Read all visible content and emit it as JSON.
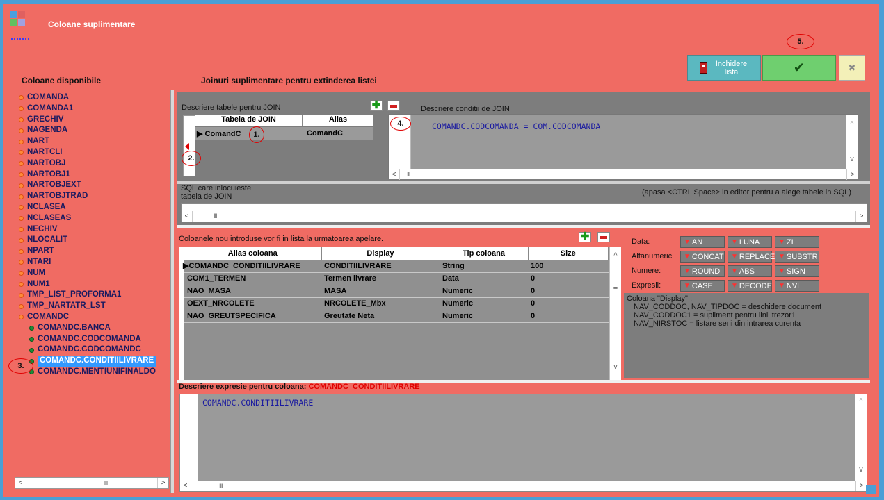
{
  "window": {
    "title": "Coloane suplimentare"
  },
  "toolbar": {
    "close_label": "Inchidere lista",
    "ok_symbol": "✔",
    "cancel_symbol": "✖",
    "step5": "5."
  },
  "left": {
    "title": "Coloane disponibile",
    "items": [
      "COMANDA",
      "COMANDA1",
      "GRECHIV",
      "NAGENDA",
      "NART",
      "NARTCLI",
      "NARTOBJ",
      "NARTOBJ1",
      "NARTOBJEXT",
      "NARTOBJTRAD",
      "NCLASEA",
      "NCLASEAS",
      "NECHIV",
      "NLOCALIT",
      "NPART",
      "NTARI",
      "NUM",
      "NUM1",
      "TMP_LIST_PROFORMA1",
      "TMP_NARTATR_LST",
      "COMANDC"
    ],
    "children": [
      "COMANDC.BANCA",
      "COMANDC.CODCOMANDA",
      "COMANDC.CODCOMANDC",
      "COMANDC.CONDITIILIVRARE",
      "COMANDC.MENTIUNIFINALDO"
    ],
    "step3": "3."
  },
  "join": {
    "section_title": "Joinuri suplimentare pentru extinderea listei",
    "tables_label": "Descriere tabele pentru JOIN",
    "conditions_label": "Descriere conditii de JOIN",
    "col_table": "Tabela de JOIN",
    "col_alias": "Alias",
    "row_table": "ComandC",
    "row_alias": "ComandC",
    "condition": "COMANDC.CODCOMANDA = COM.CODCOMANDA",
    "sql_label": "SQL care inlocuieste tabela de JOIN",
    "sql_hint": "(apasa <CTRL Space> in editor pentru a alege tabele in SQL)",
    "step1": "1.",
    "step2": "2.",
    "step4": "4."
  },
  "columns": {
    "note": "Coloanele nou introduse vor fi in lista la urmatoarea apelare.",
    "headers": [
      "Alias coloana",
      "Display",
      "Tip coloana",
      "Size"
    ],
    "rows": [
      [
        "COMANDC_CONDITIILIVRARE",
        "CONDITIILIVRARE",
        "String",
        "100"
      ],
      [
        "COM1_TERMEN",
        "Termen livrare",
        "Data",
        "0"
      ],
      [
        "NAO_MASA",
        "MASA",
        "Numeric",
        "0"
      ],
      [
        "OEXT_NRCOLETE",
        "NRCOLETE_Mbx",
        "Numeric",
        "0"
      ],
      [
        "NAO_GREUTSPECIFICA",
        "Greutate Neta",
        "Numeric",
        "0"
      ]
    ]
  },
  "functions": {
    "data_label": "Data:",
    "alfa_label": "Alfanumeric",
    "num_label": "Numere:",
    "expr_label": "Expresii:",
    "data": [
      "AN",
      "LUNA",
      "ZI"
    ],
    "alfa": [
      "CONCAT",
      "REPLACE",
      "SUBSTR"
    ],
    "num": [
      "ROUND",
      "ABS",
      "SIGN"
    ],
    "expr": [
      "CASE",
      "DECODE",
      "NVL"
    ],
    "help_title": "Coloana \"Display\" :",
    "help1": "NAV_CODDOC, NAV_TIPDOC = deschidere document",
    "help2": "NAV_CODDOC1 = supliment pentru linii trezor1",
    "help3": "NAV_NIRSTOC = listare serii din intrarea curenta"
  },
  "expression": {
    "label": "Descriere expresie pentru coloana:",
    "column": "COMANDC_CONDITIILIVRARE",
    "text": "COMANDC.CONDITIILIVRARE"
  },
  "colors": {
    "background": "#f06b63",
    "grey_panel": "#7d7d7d",
    "green": "#6fcf6f",
    "teal": "#5bb8c0"
  }
}
